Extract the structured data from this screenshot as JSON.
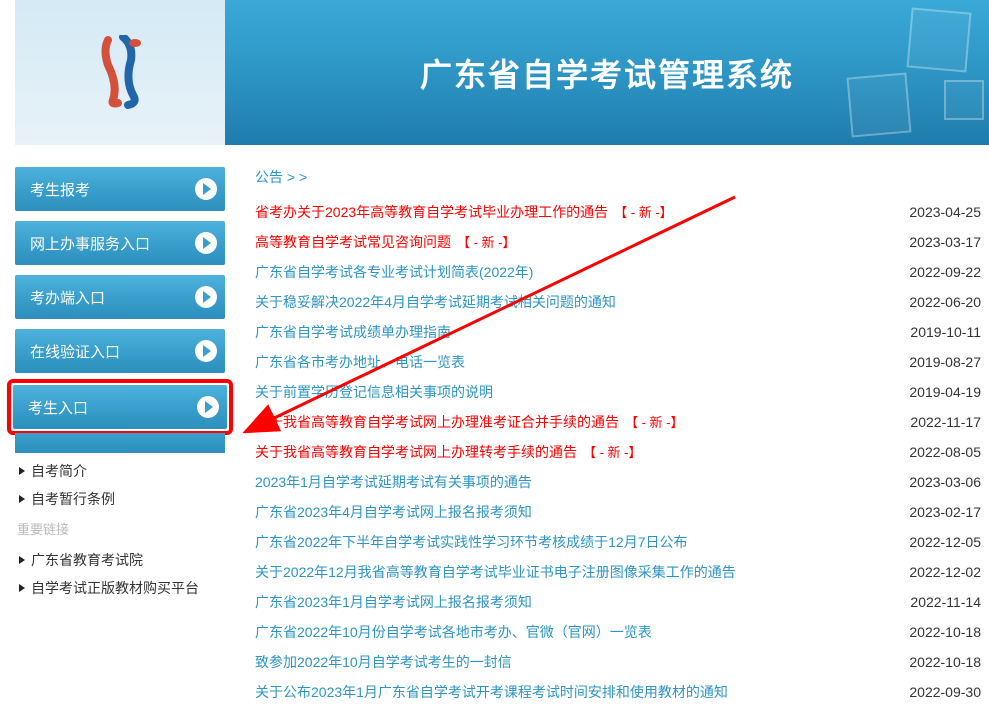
{
  "header": {
    "title": "广东省自学考试管理系统"
  },
  "sidebar": {
    "nav": [
      {
        "label": "考生报考"
      },
      {
        "label": "网上办事服务入口"
      },
      {
        "label": "考办端入口"
      },
      {
        "label": "在线验证入口"
      },
      {
        "label": "考生入口"
      }
    ],
    "links1": [
      {
        "label": "自考简介"
      },
      {
        "label": "自考暂行条例"
      }
    ],
    "section_label": "重要链接",
    "links2": [
      {
        "label": "广东省教育考试院"
      },
      {
        "label": "自学考试正版教材购买平台"
      }
    ]
  },
  "main": {
    "breadcrumb": "公告 > >",
    "new_tag": "【 - 新 -】",
    "news": [
      {
        "title": "省考办关于2023年高等教育自学考试毕业办理工作的通告",
        "date": "2023-04-25",
        "is_new": true
      },
      {
        "title": "高等教育自学考试常见咨询问题",
        "date": "2023-03-17",
        "is_new": true
      },
      {
        "title": "广东省自学考试各专业考试计划简表(2022年)",
        "date": "2022-09-22",
        "is_new": false
      },
      {
        "title": "关于稳妥解决2022年4月自学考试延期考试相关问题的通知",
        "date": "2022-06-20",
        "is_new": false
      },
      {
        "title": "广东省自学考试成绩单办理指南",
        "date": "2019-10-11",
        "is_new": false
      },
      {
        "title": "广东省各市考办地址、电话一览表",
        "date": "2019-08-27",
        "is_new": false
      },
      {
        "title": "关于前置学历登记信息相关事项的说明",
        "date": "2019-04-19",
        "is_new": false
      },
      {
        "title": "关于我省高等教育自学考试网上办理准考证合并手续的通告",
        "date": "2022-11-17",
        "is_new": true
      },
      {
        "title": "关于我省高等教育自学考试网上办理转考手续的通告",
        "date": "2022-08-05",
        "is_new": true
      },
      {
        "title": "2023年1月自学考试延期考试有关事项的通告",
        "date": "2023-03-06",
        "is_new": false
      },
      {
        "title": "广东省2023年4月自学考试网上报名报考须知",
        "date": "2023-02-17",
        "is_new": false
      },
      {
        "title": "广东省2022年下半年自学考试实践性学习环节考核成绩于12月7日公布",
        "date": "2022-12-05",
        "is_new": false
      },
      {
        "title": "关于2022年12月我省高等教育自学考试毕业证书电子注册图像采集工作的通告",
        "date": "2022-12-02",
        "is_new": false
      },
      {
        "title": "广东省2023年1月自学考试网上报名报考须知",
        "date": "2022-11-14",
        "is_new": false
      },
      {
        "title": "广东省2022年10月份自学考试各地市考办、官微（官网）一览表",
        "date": "2022-10-18",
        "is_new": false
      },
      {
        "title": "致参加2022年10月自学考试考生的一封信",
        "date": "2022-10-18",
        "is_new": false
      },
      {
        "title": "关于公布2023年1月广东省自学考试开考课程考试时间安排和使用教材的通知",
        "date": "2022-09-30",
        "is_new": false
      }
    ]
  }
}
